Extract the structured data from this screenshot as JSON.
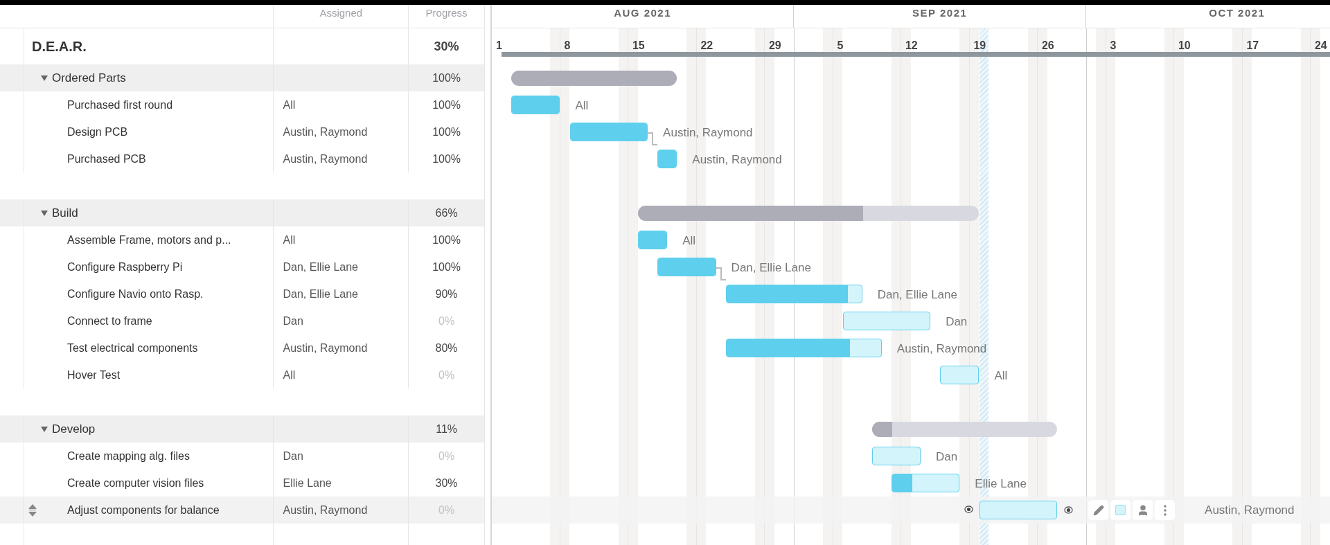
{
  "columns": {
    "assigned": "Assigned",
    "progress": "Progress"
  },
  "timeline": {
    "months": [
      {
        "label": "AUG 2021"
      },
      {
        "label": "SEP 2021"
      },
      {
        "label": "OCT 2021"
      }
    ],
    "weeks": [
      "1",
      "8",
      "15",
      "22",
      "29",
      "5",
      "12",
      "19",
      "26",
      "3",
      "10",
      "17",
      "24"
    ]
  },
  "project": {
    "name": "D.E.A.R.",
    "progress": "30%"
  },
  "groups": [
    {
      "name": "Ordered Parts",
      "expanded": true,
      "progress": "100%",
      "level": 1,
      "tasks": [
        {
          "name": "Purchased first round",
          "assigned": "All",
          "progress": "100%",
          "level": 1,
          "linked": false,
          "selected": false,
          "bar_label": "All"
        },
        {
          "name": "Design PCB",
          "assigned": "Austin, Raymond",
          "progress": "100%",
          "level": 1,
          "linked": false,
          "selected": false,
          "bar_label": "Austin, Raymond"
        },
        {
          "name": "Purchased PCB",
          "assigned": "Austin, Raymond",
          "progress": "100%",
          "level": 1,
          "linked": true,
          "selected": false,
          "bar_label": "Austin, Raymond"
        }
      ]
    },
    {
      "name": "Build",
      "expanded": true,
      "progress": "66%",
      "level": 0.66,
      "tasks": [
        {
          "name": "Assemble Frame, motors and p...",
          "assigned": "All",
          "progress": "100%",
          "level": 1,
          "linked": false,
          "selected": false,
          "bar_label": "All"
        },
        {
          "name": "Configure Raspberry Pi",
          "assigned": "Dan, Ellie Lane",
          "progress": "100%",
          "level": 1,
          "linked": false,
          "selected": false,
          "bar_label": "Dan, Ellie Lane"
        },
        {
          "name": "Configure Navio onto Rasp.",
          "assigned": "Dan, Ellie Lane",
          "progress": "90%",
          "level": 0.9,
          "linked": true,
          "selected": false,
          "bar_label": "Dan, Ellie Lane"
        },
        {
          "name": "Connect to frame",
          "assigned": "Dan",
          "progress": "0%",
          "level": 0,
          "linked": false,
          "selected": false,
          "bar_label": "Dan"
        },
        {
          "name": "Test electrical components",
          "assigned": "Austin, Raymond",
          "progress": "80%",
          "level": 0.8,
          "linked": false,
          "selected": false,
          "bar_label": "Austin, Raymond"
        },
        {
          "name": "Hover Test",
          "assigned": "All",
          "progress": "0%",
          "level": 0,
          "linked": false,
          "selected": false,
          "bar_label": "All"
        }
      ]
    },
    {
      "name": "Develop",
      "expanded": true,
      "progress": "11%",
      "level": 0.11,
      "tasks": [
        {
          "name": "Create mapping alg. files",
          "assigned": "Dan",
          "progress": "0%",
          "level": 0,
          "linked": false,
          "selected": false,
          "bar_label": "Dan"
        },
        {
          "name": "Create computer vision files",
          "assigned": "Ellie Lane",
          "progress": "30%",
          "level": 0.3,
          "linked": false,
          "selected": false,
          "bar_label": "Ellie Lane"
        },
        {
          "name": "Adjust components for balance",
          "assigned": "Austin, Raymond",
          "progress": "0%",
          "level": 0,
          "linked": false,
          "selected": true,
          "bar_label": "Austin, Raymond"
        }
      ]
    }
  ]
}
